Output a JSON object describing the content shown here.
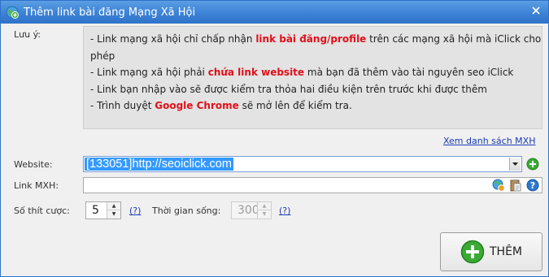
{
  "window": {
    "title": "Thêm link bài đăng Mạng Xã Hội"
  },
  "form": {
    "note_label": "Lưu ý:",
    "notes": [
      {
        "pre": "- Link mạng xã hội chỉ chấp nhận ",
        "hl": "link bài đăng/profile",
        "post": " trên các mạng xã hội mà iClick cho"
      },
      {
        "pre": "phép",
        "hl": "",
        "post": ""
      },
      {
        "pre": "- Link mạng xã hội phải ",
        "hl": "chứa link website",
        "post": " mà bạn đã thêm vào tài nguyên seo iClick"
      },
      {
        "pre": "- Link bạn nhập vào sẽ được kiểm tra thỏa hai điều kiện trên trước khi được thêm",
        "hl": "",
        "post": ""
      },
      {
        "pre": "- Trình duyệt ",
        "hl": "Google Chrome",
        "post": " sẽ mở lên để kiểm tra."
      }
    ],
    "view_list_link": "Xem danh sách MXH",
    "website_label": "Website:",
    "website_value": "[133051]http://seoiclick.com",
    "link_label": "Link MXH:",
    "link_value": "",
    "bids_label": "Số thít cược:",
    "bids_value": "5",
    "help1": "(?)",
    "lifetime_label": "Thời gian sống:",
    "lifetime_value": "300",
    "help2": "(?)",
    "add_button": "THÊM"
  },
  "colors": {
    "titlebar": "#3c82d6",
    "highlight": "#e0101a",
    "selection": "#3399ff",
    "link": "#1a3cb4",
    "add_icon": "#3aaa35"
  },
  "icons": [
    "earth-plus-icon",
    "close-icon",
    "add-website-icon",
    "globe-check-icon",
    "clipboard-icon",
    "help-icon",
    "add-circle-icon"
  ]
}
